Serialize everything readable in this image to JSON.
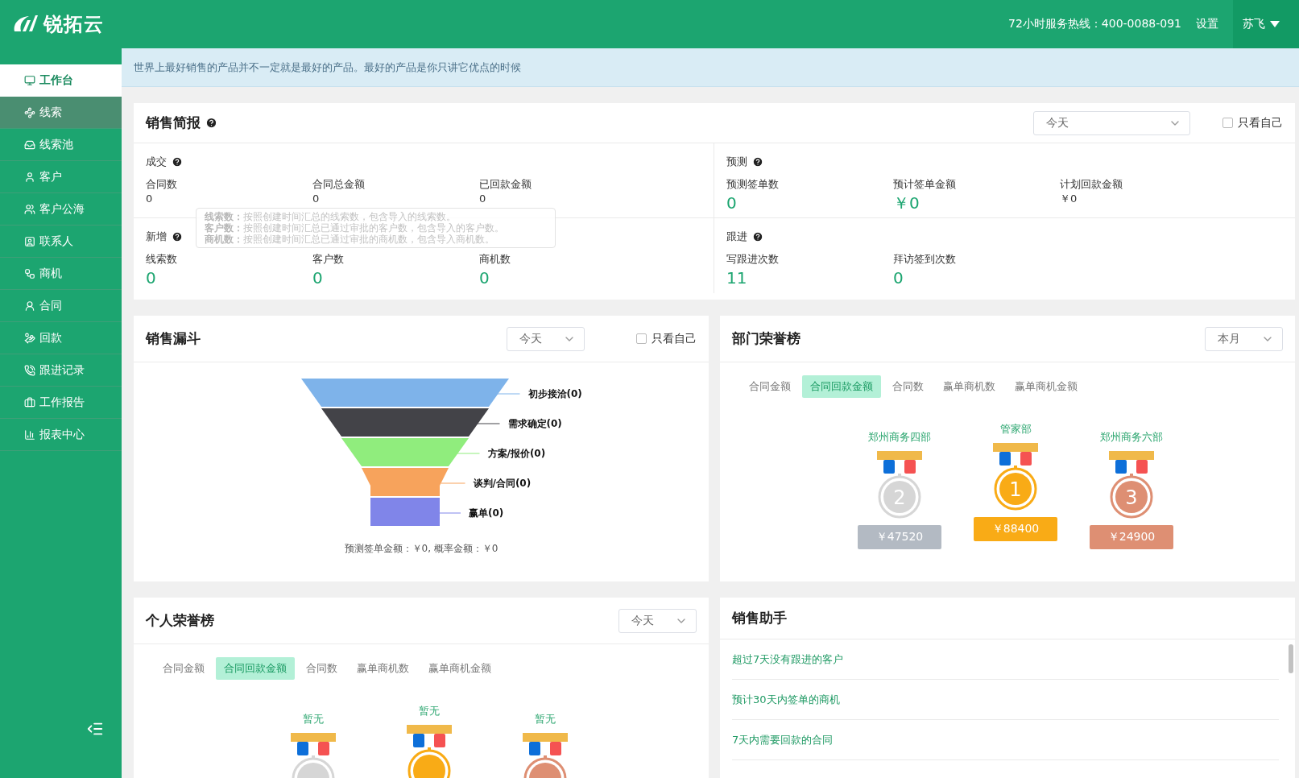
{
  "header": {
    "logo": "锐拓云",
    "hotline": "72小时服务热线：400-0088-091",
    "settings": "设置",
    "user": "苏飞"
  },
  "sidebar": {
    "items": [
      {
        "label": "工作台",
        "selected": true,
        "hovered": false
      },
      {
        "label": "线索",
        "selected": false,
        "hovered": true
      },
      {
        "label": "线索池",
        "selected": false,
        "hovered": false
      },
      {
        "label": "客户",
        "selected": false,
        "hovered": false
      },
      {
        "label": "客户公海",
        "selected": false,
        "hovered": false
      },
      {
        "label": "联系人",
        "selected": false,
        "hovered": false
      },
      {
        "label": "商机",
        "selected": false,
        "hovered": false
      },
      {
        "label": "合同",
        "selected": false,
        "hovered": false
      },
      {
        "label": "回款",
        "selected": false,
        "hovered": false
      },
      {
        "label": "跟进记录",
        "selected": false,
        "hovered": false
      },
      {
        "label": "工作报告",
        "selected": false,
        "hovered": false
      },
      {
        "label": "报表中心",
        "selected": false,
        "hovered": false
      }
    ]
  },
  "notice": "世界上最好销售的产品并不一定就是最好的产品。最好的产品是你只讲它优点的时候",
  "sales_brief": {
    "title": "销售简报",
    "period": "今天",
    "only_mine": {
      "label": "只看自己",
      "checked": false
    },
    "sections": [
      {
        "title": "成交",
        "stats": [
          {
            "label": "合同数",
            "value": "0",
            "highlight": false
          },
          {
            "label": "合同总金额",
            "value": "0",
            "highlight": false
          },
          {
            "label": "已回款金额",
            "value": "0",
            "highlight": false
          }
        ]
      },
      {
        "title": "预测",
        "stats": [
          {
            "label": "预测签单数",
            "value": "0",
            "highlight": true
          },
          {
            "label": "预计签单金额",
            "value": "￥0",
            "highlight": true
          },
          {
            "label": "计划回款金额",
            "value": "￥0",
            "highlight": false
          }
        ]
      },
      {
        "title": "新增",
        "stats": [
          {
            "label": "线索数",
            "value": "0",
            "highlight": true
          },
          {
            "label": "客户数",
            "value": "0",
            "highlight": true
          },
          {
            "label": "商机数",
            "value": "0",
            "highlight": true
          }
        ]
      },
      {
        "title": "跟进",
        "stats": [
          {
            "label": "写跟进次数",
            "value": "11",
            "highlight": true
          },
          {
            "label": "拜访签到次数",
            "value": "0",
            "highlight": true
          }
        ]
      }
    ],
    "tooltip": {
      "lines": [
        "**线索数：**按照创建时间汇总的线索数，包含导入的线索数。",
        "**客户数：**按照创建时间汇总已通过审批的客户数，包含导入的客户数。",
        "**商机数：**按照创建时间汇总已通过审批的商机数，包含导入商机数。"
      ]
    }
  },
  "funnel": {
    "title": "销售漏斗",
    "period": "今天",
    "only_mine": {
      "label": "只看自己",
      "checked": false
    },
    "stages": [
      {
        "label": "初步接洽(0)",
        "color": "#7eb3ea"
      },
      {
        "label": "需求确定(0)",
        "color": "#434348"
      },
      {
        "label": "方案/报价(0)",
        "color": "#90ed7d"
      },
      {
        "label": "谈判/合同(0)",
        "color": "#f7a35c"
      },
      {
        "label": "赢单(0)",
        "color": "#8085e9"
      }
    ],
    "summary": "预测签单金额：￥0, 概率金额：￥0"
  },
  "dept_honor": {
    "title": "部门荣誉榜",
    "period": "本月",
    "tabs": [
      {
        "label": "合同金额",
        "selected": false
      },
      {
        "label": "合同回款金额",
        "selected": true
      },
      {
        "label": "合同数",
        "selected": false
      },
      {
        "label": "赢单商机数",
        "selected": false
      },
      {
        "label": "赢单商机金额",
        "selected": false
      }
    ],
    "podium": [
      {
        "name": "郑州商务四部",
        "rank": "2",
        "amount": "￥47520",
        "kind": "silver"
      },
      {
        "name": "管家部",
        "rank": "1",
        "amount": "￥88400",
        "kind": "gold"
      },
      {
        "name": "郑州商务六部",
        "rank": "3",
        "amount": "￥24900",
        "kind": "bronze"
      }
    ]
  },
  "personal_honor": {
    "title": "个人荣誉榜",
    "period": "今天",
    "tabs": [
      {
        "label": "合同金额",
        "selected": false
      },
      {
        "label": "合同回款金额",
        "selected": true
      },
      {
        "label": "合同数",
        "selected": false
      },
      {
        "label": "赢单商机数",
        "selected": false
      },
      {
        "label": "赢单商机金额",
        "selected": false
      }
    ],
    "podium": [
      {
        "name": "暂无",
        "kind": "silver"
      },
      {
        "name": "暂无",
        "kind": "gold"
      },
      {
        "name": "暂无",
        "kind": "bronze"
      }
    ]
  },
  "assistant": {
    "title": "销售助手",
    "items": [
      "超过7天没有跟进的客户",
      "预计30天内签单的商机",
      "7天内需要回款的合同"
    ]
  }
}
